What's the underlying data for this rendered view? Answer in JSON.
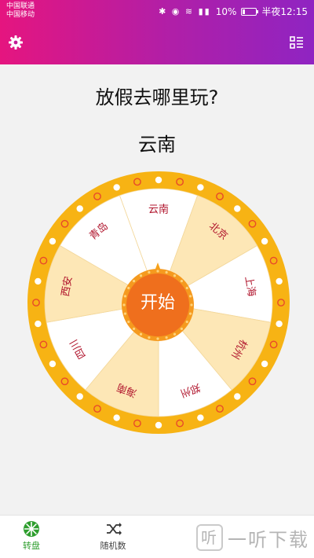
{
  "status_bar": {
    "carrier_1": "中国联通",
    "carrier_2": "中国移动",
    "battery": "10%",
    "time": "半夜12:15"
  },
  "app": {
    "question": "放假去哪里玩?",
    "result": "云南",
    "start_label": "开始"
  },
  "wheel": {
    "segments": [
      "云南",
      "北京",
      "上海",
      "杭州",
      "郑州",
      "海南",
      "四川",
      "西安",
      "青岛"
    ],
    "colors": {
      "light": "#fde7b6",
      "white": "#ffffff",
      "rim": "#f7b314",
      "text": "#b0142c"
    }
  },
  "nav": {
    "tabs": [
      {
        "label": "转盘",
        "active": true
      },
      {
        "label": "随机数",
        "active": false
      }
    ]
  },
  "watermark": {
    "text": "一听下载",
    "mark": "听"
  },
  "colors": {
    "header_start": "#e5157f",
    "header_end": "#8f24c2",
    "active_tab": "#2e9e2e",
    "button": "#f07a1a"
  }
}
